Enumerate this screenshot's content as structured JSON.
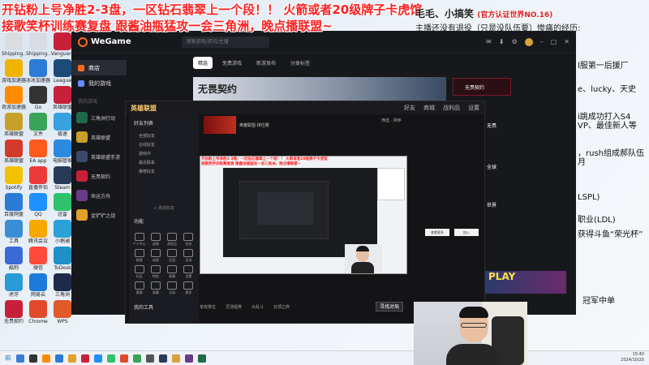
{
  "overlay": {
    "line1": "开钻粉上号净胜2-3盘，一区钻石翡翠上一个段！！  火箭或者20级牌子卡虎馆",
    "line2": "接歌笑杯训练赛复盘   跟酱油瓶猛攻一会三角洲，晚点播联盟~",
    "streamer": "毛毛、小搞笑",
    "badge": "(官方认证世界NO.16)",
    "subline": "主播还没有退役（只是没队伍要）惨痛的经历:"
  },
  "right_side_text": [
    "l服第一后援厂",
    "e、lucky、天史",
    "i跳成功打入S4",
    "VP、最佳新人等",
    "，rush组成郝队伍",
    "月",
    "LSPL)",
    "职业(LDL)",
    "获得斗鱼“荣光杯”",
    "冠军中单"
  ],
  "desktop_icons": [
    {
      "label": "Shipping...",
      "color": "#d9dde2"
    },
    {
      "label": "Shipping...",
      "color": "#d9dde2"
    },
    {
      "label": "Vanguard",
      "color": "#c8203a"
    },
    {
      "label": "游戏加速器",
      "color": "#f0b400"
    },
    {
      "label": "冰冰加速器",
      "color": "#2d7bd5"
    },
    {
      "label": "League of...",
      "color": "#1e4a7a"
    },
    {
      "label": "奇游加速器",
      "color": "#ff8a00"
    },
    {
      "label": "Go",
      "color": "#333333"
    },
    {
      "label": "英雄联盟",
      "color": "#c8203a"
    },
    {
      "label": "英雄联盟",
      "color": "#c7a02a"
    },
    {
      "label": "文件",
      "color": "#3aa35a"
    },
    {
      "label": "极速",
      "color": "#3aa0e0"
    },
    {
      "label": "英雄联盟",
      "color": "#d23a2a"
    },
    {
      "label": "EA app",
      "color": "#ff5a1e"
    },
    {
      "label": "电脑管家",
      "color": "#2c8be0"
    },
    {
      "label": "Spotify",
      "color": "#f2c200"
    },
    {
      "label": "直播伴侣",
      "color": "#ec3a3a"
    },
    {
      "label": "Steam",
      "color": "#2a3b5a"
    },
    {
      "label": "百度网盘",
      "color": "#2a7bd5"
    },
    {
      "label": "QQ",
      "color": "#1e90ff"
    },
    {
      "label": "迅雷",
      "color": "#2ec36b"
    },
    {
      "label": "工具",
      "color": "#3a8ed5"
    },
    {
      "label": "腾讯会议",
      "color": "#f6a800"
    },
    {
      "label": "小鹅通",
      "color": "#2ba1d8"
    },
    {
      "label": "酷狗",
      "color": "#3a6ad5"
    },
    {
      "label": "微信",
      "color": "#ff4a3a"
    },
    {
      "label": "ToDesk",
      "color": "#1e90c8"
    },
    {
      "label": "虎牙",
      "color": "#2a9ad8"
    },
    {
      "label": "网易云",
      "color": "#1e7ad8"
    },
    {
      "label": "三角洲",
      "color": "#1e2a4a"
    },
    {
      "label": "无畏契约",
      "color": "#c8203a"
    },
    {
      "label": "Chrome",
      "color": "#e04a2a"
    },
    {
      "label": "WPS",
      "color": "#e05a2a"
    }
  ],
  "wegame": {
    "logo": "WeGame",
    "search_placeholder": "搜索游戏/资讯/主播",
    "nav": [
      {
        "label": "商店",
        "active": true
      },
      {
        "label": "我的游戏",
        "active": false
      }
    ],
    "section_label": "我的游戏",
    "games": [
      {
        "label": "三角洲行动",
        "color": "#1e6a4a"
      },
      {
        "label": "英雄联盟",
        "color": "#c7a02a"
      },
      {
        "label": "英雄联盟手游",
        "color": "#3a4a6a"
      },
      {
        "label": "无畏契约",
        "color": "#c8203a"
      },
      {
        "label": "命运方舟",
        "color": "#6a3a8a"
      },
      {
        "label": "金铲铲之战",
        "color": "#e0a02a"
      }
    ],
    "tabs": [
      {
        "label": "精选",
        "active": true
      },
      {
        "label": "免费游戏",
        "active": false
      },
      {
        "label": "新游发布",
        "active": false
      },
      {
        "label": "分类标签",
        "active": false
      }
    ],
    "banner_title": "无畏契约",
    "banner_right_label": "无畏契约",
    "list_items": [
      "无畏",
      "全球",
      "世界"
    ]
  },
  "lol": {
    "logo": "英雄联盟",
    "tools": [
      "好友",
      "商城",
      "战利品",
      "设置"
    ],
    "left_title": "好友列表",
    "left_items": [
      "全部好友",
      "在线好友",
      "游戏中",
      "最近联系",
      "推荐好友"
    ],
    "left_add": "+ 添加好友",
    "grid_title": "功能",
    "grid": [
      "个人中心",
      "战绩",
      "战利品",
      "任务",
      "商城",
      "成就",
      "生涯",
      "活动",
      "社区",
      "特权",
      "赛事",
      "设置",
      "客服",
      "收藏",
      "记录",
      "更多"
    ],
    "grid_title2": "我的工具",
    "head_text": "英雄联盟·排位赛",
    "filter": "筛选 · 排序",
    "panel_buttons": [
      "查看更多",
      "加入"
    ],
    "bottom": [
      "单双排位",
      "灵活组排",
      "大乱斗",
      "云顶之弈"
    ],
    "start": "寻找对局"
  },
  "capture": {
    "line1": "开钻粉上号净胜2-3盘，一区钻石翡翠上一个段！！  火箭或者20级牌子卡虎馆",
    "line2": "接歌笑杯训练赛复盘   跟酱油瓶猛攻一会三角洲，晚点播联盟~"
  },
  "right_thumb": "PLAY",
  "taskbar": {
    "time": "15:40",
    "date": "2024/10/20",
    "icons": [
      "#3a7bd5",
      "#333333",
      "#ff8a00",
      "#2a7bd5",
      "#e0a02a",
      "#c8203a",
      "#1e90ff",
      "#2ec36b",
      "#e04a2a",
      "#3aa35a",
      "#555555",
      "#2a3b5a",
      "#d9a23c",
      "#6a3a8a",
      "#1e6a4a"
    ]
  }
}
